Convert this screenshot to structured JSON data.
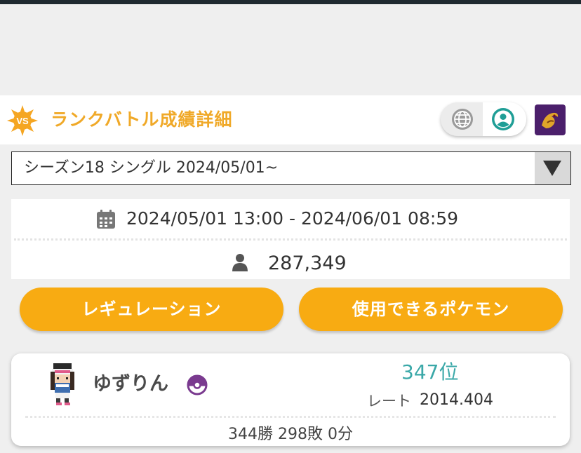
{
  "header": {
    "title": "ランクバトル成績詳細",
    "vs_badge_text": "VS",
    "colors": {
      "title": "#f0a928",
      "badge": "#f5a623"
    },
    "icons": [
      "globe-icon",
      "user-circle-icon",
      "dragon-emblem-icon"
    ]
  },
  "season_select": {
    "selected": "シーズン18 シングル 2024/05/01~",
    "arrow_icon": "caret-down-icon"
  },
  "season_info": {
    "period": "2024/05/01 13:00 - 2024/06/01 08:59",
    "player_count": "287,349",
    "icons": [
      "calendar-icon",
      "person-icon"
    ]
  },
  "buttons": {
    "regulation": "レギュレーション",
    "usable_pokemon": "使用できるポケモン",
    "color": "#f8ab12"
  },
  "player": {
    "name": "ゆずりん",
    "rank": "347位",
    "rate_label": "レート",
    "rate_value": "2014.404",
    "record": "344勝 298敗 0分",
    "colors": {
      "rank": "#3aa8a8"
    }
  }
}
